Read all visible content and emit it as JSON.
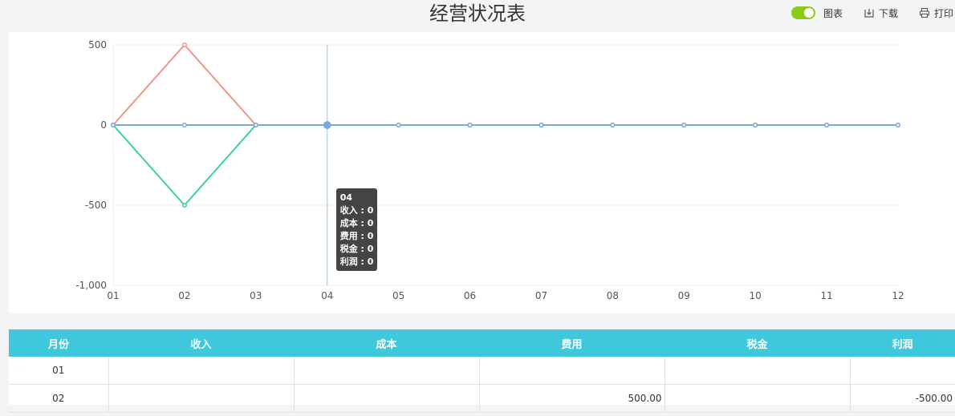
{
  "page": {
    "title": "经营状况表"
  },
  "toolbar": {
    "chart_toggle_label": "图表",
    "chart_toggle_on": true,
    "download_label": "下载",
    "print_label": "打印",
    "accent": "#8bcc1a"
  },
  "chart_data": {
    "type": "line",
    "categories": [
      "01",
      "02",
      "03",
      "04",
      "05",
      "06",
      "07",
      "08",
      "09",
      "10",
      "11",
      "12"
    ],
    "y_ticks": [
      "500",
      "0",
      "-500",
      "-1,000"
    ],
    "ylim": [
      -1000,
      500
    ],
    "grid": true,
    "series": [
      {
        "name": "收入",
        "color": "#f0958a",
        "values": [
          0,
          500,
          0,
          0,
          0,
          0,
          0,
          0,
          0,
          0,
          0,
          0
        ]
      },
      {
        "name": "利润",
        "color": "#3ccfa6",
        "values": [
          0,
          -500,
          0,
          0,
          0,
          0,
          0,
          0,
          0,
          0,
          0,
          0
        ]
      },
      {
        "name": "成本",
        "color": "#7aa6e6",
        "values": [
          0,
          0,
          0,
          0,
          0,
          0,
          0,
          0,
          0,
          0,
          0,
          0
        ]
      }
    ],
    "hover_index": 3,
    "tooltip": {
      "header": "04",
      "lines": [
        "收入 : 0",
        "成本 : 0",
        "费用 : 0",
        "税金 : 0",
        "利润 : 0"
      ]
    }
  },
  "table": {
    "header_color": "#3fc8dc",
    "columns": [
      "月份",
      "收入",
      "成本",
      "费用",
      "税金",
      "利润"
    ],
    "rows": [
      [
        "01",
        "",
        "",
        "",
        "",
        ""
      ],
      [
        "02",
        "",
        "",
        "500.00",
        "",
        "-500.00"
      ]
    ]
  }
}
